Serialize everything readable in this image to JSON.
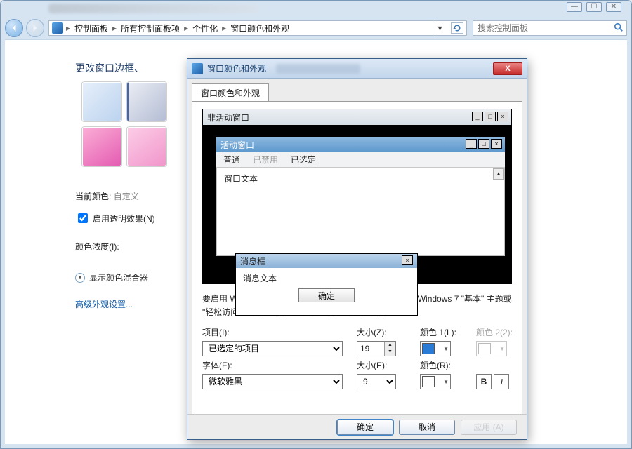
{
  "breadcrumbs": {
    "root": "控制面板",
    "b1": "所有控制面板项",
    "b2": "个性化",
    "b3": "窗口颜色和外观"
  },
  "search": {
    "placeholder": "搜索控制面板"
  },
  "bg_page": {
    "heading": "更改窗口边框、",
    "current_color_label": "当前颜色:",
    "current_color_value": "自定义",
    "enable_trans": "启用透明效果(N)",
    "intensity": "颜色浓度(I):",
    "mixer": "显示颜色混合器",
    "adv_link": "高级外观设置..."
  },
  "dialog": {
    "title": "窗口颜色和外观",
    "tab": "窗口颜色和外观",
    "preview": {
      "inactive": "非活动窗口",
      "active": "活动窗口",
      "menu_normal": "普通",
      "menu_disabled": "已禁用",
      "menu_selected": "已选定",
      "window_text": "窗口文本",
      "msg_title": "消息框",
      "msg_body": "消息文本",
      "msg_ok": "确定"
    },
    "hint": "要启用 Windows Aero，请选择 Windows 主题。只有选择 Windows 7 \"基本\" 主题或 \"轻松访问\" 主题，才能应用此处选择的颜色和大小。",
    "item_label": "项目(I):",
    "item_value": "已选定的项目",
    "size_z": "大小(Z):",
    "size_z_val": "19",
    "color1": "颜色 1(L):",
    "color2": "颜色 2(2):",
    "color1_hex": "#2a7bd6",
    "font_label": "字体(F):",
    "font_value": "微软雅黑",
    "size_e": "大小(E):",
    "size_e_val": "9",
    "color_r": "颜色(R):",
    "color_r_hex": "#ffffff",
    "ok": "确定",
    "cancel": "取消",
    "apply": "应用 (A)"
  }
}
